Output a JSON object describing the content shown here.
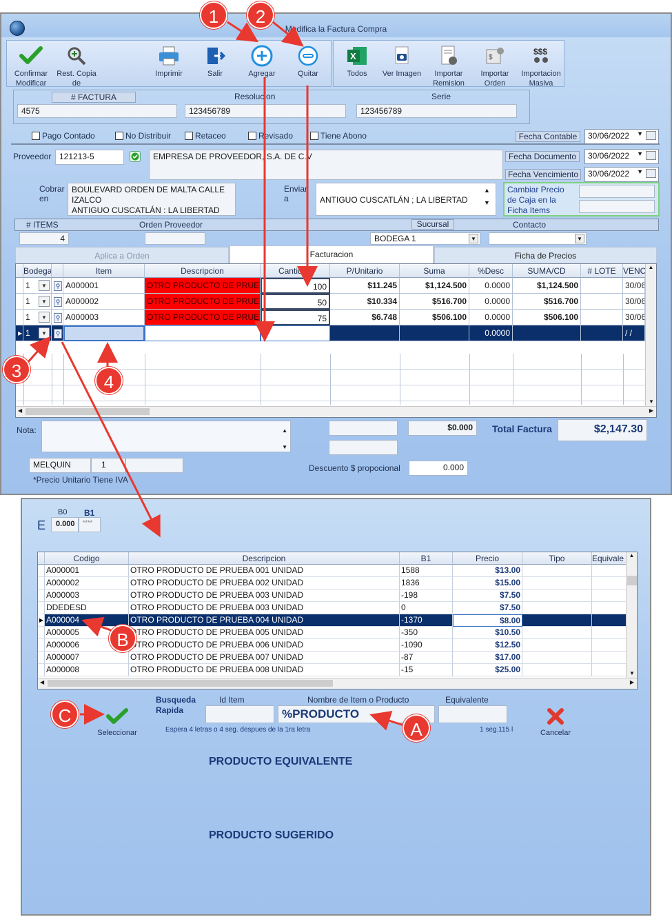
{
  "colors": {
    "accent": "#0a2f6b",
    "callout": "#e8382f",
    "red_cell": "#ff0000",
    "green": "#2aa02a"
  },
  "window": {
    "title": "Modifica la Factura Compra"
  },
  "toolbar": {
    "confirm": "Confirmar Modificar",
    "restore": "Rest. Copia de",
    "print": "Imprimir",
    "exit": "Salir",
    "add": "Agregar",
    "remove": "Quitar",
    "all": "Todos",
    "view_image": "Ver Imagen",
    "import_remision": "Importar Remision",
    "import_order": "Importar Orden",
    "import_massive": "Importacion Masiva"
  },
  "header": {
    "factura_label": "# FACTURA",
    "factura_value": "4575",
    "resolucion_label": "Resolucion",
    "resolucion_value": "123456789",
    "serie_label": "Serie",
    "serie_value": "123456789"
  },
  "checks": {
    "pago_contado": "Pago Contado",
    "no_distribuir": "No Distribuir",
    "retaceo": "Retaceo",
    "revisado": "Revisado",
    "tiene_abono": "Tiene Abono"
  },
  "dates": {
    "contable_label": "Fecha Contable",
    "contable_value": "30/06/2022",
    "documento_label": "Fecha Documento",
    "documento_value": "30/06/2022",
    "vencimiento_label": "Fecha Vencimiento",
    "vencimiento_value": "30/06/2022"
  },
  "proveedor": {
    "label": "Proveedor",
    "code": "121213-5",
    "name": "EMPRESA DE PROVEEDOR, S.A. DE C.V",
    "cobrar_label_1": "Cobrar",
    "cobrar_label_2": "en",
    "cobrar_line1": "BOULEVARD ORDEN DE MALTA CALLE",
    "cobrar_line2": "IZALCO",
    "cobrar_line3": "ANTIGUO CUSCATLÁN : LA LIBERTAD",
    "enviar_label_1": "Enviar",
    "enviar_label_2": "a",
    "enviar_value": "ANTIGUO CUSCATLÁN ; LA LIBERTAD"
  },
  "cambiar_precio": {
    "line1": "Cambiar Precio",
    "line2": "de Caja en la",
    "line3": "Ficha Items"
  },
  "info_row": {
    "items_label": "# ITEMS",
    "items_value": "4",
    "orden_label": "Orden Proveedor",
    "sucursal_label": "Sucursal",
    "sucursal_value": "BODEGA 1",
    "contacto_label": "Contacto"
  },
  "tabs": {
    "aplica": "Aplica a Orden",
    "facturacion": "Facturacion",
    "ficha": "Ficha de Precios"
  },
  "grid": {
    "columns": [
      "Bodega",
      "Item",
      "Descripcion",
      "Cantidad",
      "P/Unitario",
      "Suma",
      "%Desc",
      "SUMA/CD",
      "# LOTE",
      "VENC"
    ],
    "rows": [
      {
        "bodega": "1",
        "item": "A000001",
        "desc": "OTRO PRODUCTO DE PRUE",
        "cant": "100",
        "pu": "$11.245",
        "suma": "$1,124.500",
        "desc_pct": "0.0000",
        "sumacd": "$1,124.500",
        "lote": "",
        "venc": "30/06"
      },
      {
        "bodega": "1",
        "item": "A000002",
        "desc": "OTRO PRODUCTO DE PRUE",
        "cant": "50",
        "pu": "$10.334",
        "suma": "$516.700",
        "desc_pct": "0.0000",
        "sumacd": "$516.700",
        "lote": "",
        "venc": "30/06"
      },
      {
        "bodega": "1",
        "item": "A000003",
        "desc": "OTRO PRODUCTO DE PRUE",
        "cant": "75",
        "pu": "$6.748",
        "suma": "$506.100",
        "desc_pct": "0.0000",
        "sumacd": "$506.100",
        "lote": "",
        "venc": "30/06"
      },
      {
        "bodega": "1",
        "item": "",
        "desc": "",
        "cant": "",
        "pu": "",
        "suma": "",
        "desc_pct": "0.0000",
        "sumacd": "",
        "lote": "",
        "venc": "/ /"
      }
    ]
  },
  "footer": {
    "nota_label": "Nota:",
    "descuento_value": "$0.000",
    "total_label": "Total Factura",
    "total_value": "$2,147.30",
    "user": "MELQUIN",
    "user_num": "1",
    "precio_note": "*Precio Unitario Tiene IVA",
    "descuento_prop_label": "Descuento $ propocional",
    "descuento_prop_value": "0.000"
  },
  "callouts": {
    "c1": "1",
    "c2": "2",
    "c3": "3",
    "c4": "4",
    "ca": "A",
    "cb": "B",
    "cc": "C"
  },
  "search": {
    "e_label": "E",
    "b0_label": "B0",
    "b1_label": "B1",
    "b0_value": "0.000",
    "b1_value": "****",
    "columns": [
      "Codigo",
      "Descripcion",
      "B1",
      "Precio",
      "Tipo",
      "Equivale"
    ],
    "rows": [
      {
        "code": "A000001",
        "desc": "OTRO PRODUCTO DE PRUEBA 001 UNIDAD",
        "b1": "1588",
        "price": "$13.00"
      },
      {
        "code": "A000002",
        "desc": "OTRO PRODUCTO DE PRUEBA 002 UNIDAD",
        "b1": "1836",
        "price": "$15.00"
      },
      {
        "code": "A000003",
        "desc": "OTRO PRODUCTO DE PRUEBA 003 UNIDAD",
        "b1": "-198",
        "price": "$7.50"
      },
      {
        "code": "DDEDESD",
        "desc": "OTRO PRODUCTO DE PRUEBA 003 UNIDAD",
        "b1": "0",
        "price": "$7.50"
      },
      {
        "code": "A000004",
        "desc": "OTRO PRODUCTO DE PRUEBA 004 UNIDAD",
        "b1": "-1370",
        "price": "$8.00"
      },
      {
        "code": "A000005",
        "desc": "OTRO PRODUCTO DE PRUEBA 005 UNIDAD",
        "b1": "-350",
        "price": "$10.50"
      },
      {
        "code": "A000006",
        "desc": "OTRO PRODUCTO DE PRUEBA 006 UNIDAD",
        "b1": "-1090",
        "price": "$12.50"
      },
      {
        "code": "A000007",
        "desc": "OTRO PRODUCTO DE PRUEBA 007 UNIDAD",
        "b1": "-87",
        "price": "$17.00"
      },
      {
        "code": "A000008",
        "desc": "OTRO PRODUCTO DE PRUEBA 008 UNIDAD",
        "b1": "-15",
        "price": "$25.00"
      }
    ],
    "busqueda_1": "Busqueda",
    "busqueda_2": "Rapida",
    "id_label": "Id Item",
    "name_label": "Nombre de Item o Producto",
    "name_value": "%PRODUCTO",
    "equiv_label": "Equivalente",
    "hint": "Espera 4 letras o 4 seg. despues de la 1ra letra",
    "timing": "1 seg.115 l",
    "select_label": "Seleccionar",
    "cancel_label": "Cancelar",
    "producto_equivalente": "PRODUCTO EQUIVALENTE",
    "producto_sugerido": "PRODUCTO SUGERIDO"
  }
}
